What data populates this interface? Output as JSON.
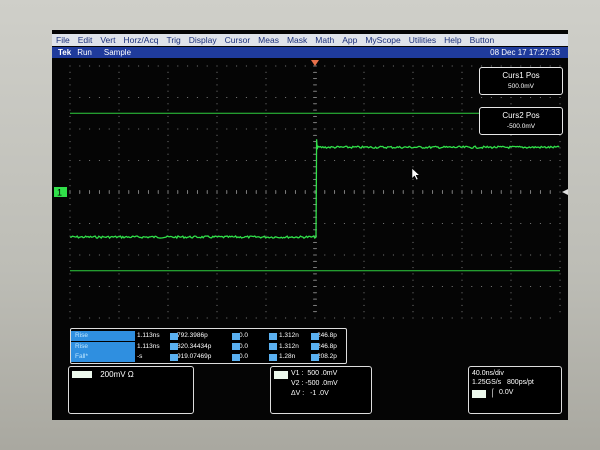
{
  "menu": [
    "File",
    "Edit",
    "Vert",
    "Horz/Acq",
    "Trig",
    "Display",
    "Cursor",
    "Meas",
    "Mask",
    "Math",
    "App",
    "MyScope",
    "Utilities",
    "Help",
    "Button"
  ],
  "status": {
    "brand": "Tek",
    "run": "Run",
    "mode": "Sample",
    "date": "08 Dec 17 17:27:33"
  },
  "channel": {
    "label": "1",
    "color": "#31e04a"
  },
  "cursor_readouts": [
    {
      "title": "Curs1 Pos",
      "value": "500.0mV"
    },
    {
      "title": "Curs2 Pos",
      "value": "-500.0mV"
    }
  ],
  "measurements": [
    {
      "name": "Rise",
      "value": "1.113ns",
      "mu": "792.3986p",
      "min": "0.0",
      "max": "1.312n",
      "sd": "246.8p"
    },
    {
      "name": "Rise",
      "value": "1.113ns",
      "mu": "820.34434p",
      "min": "0.0",
      "max": "1.312n",
      "sd": "246.8p"
    },
    {
      "name": "Fall*",
      "value": "-s",
      "mu": "919.07469p",
      "min": "0.0",
      "max": "1.28n",
      "sd": "208.2p"
    }
  ],
  "stat_icons": [
    "μ",
    "m",
    "M",
    "σ"
  ],
  "scale": {
    "vertical": "200mV Ω"
  },
  "cursor_box": {
    "v1": "V1 :  500 .0mV",
    "v2": "V2 : -500 .0mV",
    "dv": "ΔV :   -1 .0V"
  },
  "horizontal": {
    "timebase": "40.0ns/div",
    "rate": "1.25GS/s   800ps/pt",
    "trigger": "0.0V"
  },
  "colors": {
    "trace": "#31e04a",
    "cursor": "#2fcf3f",
    "menubar": "#dfe3ea",
    "statusbar": "#1f3b9c"
  }
}
